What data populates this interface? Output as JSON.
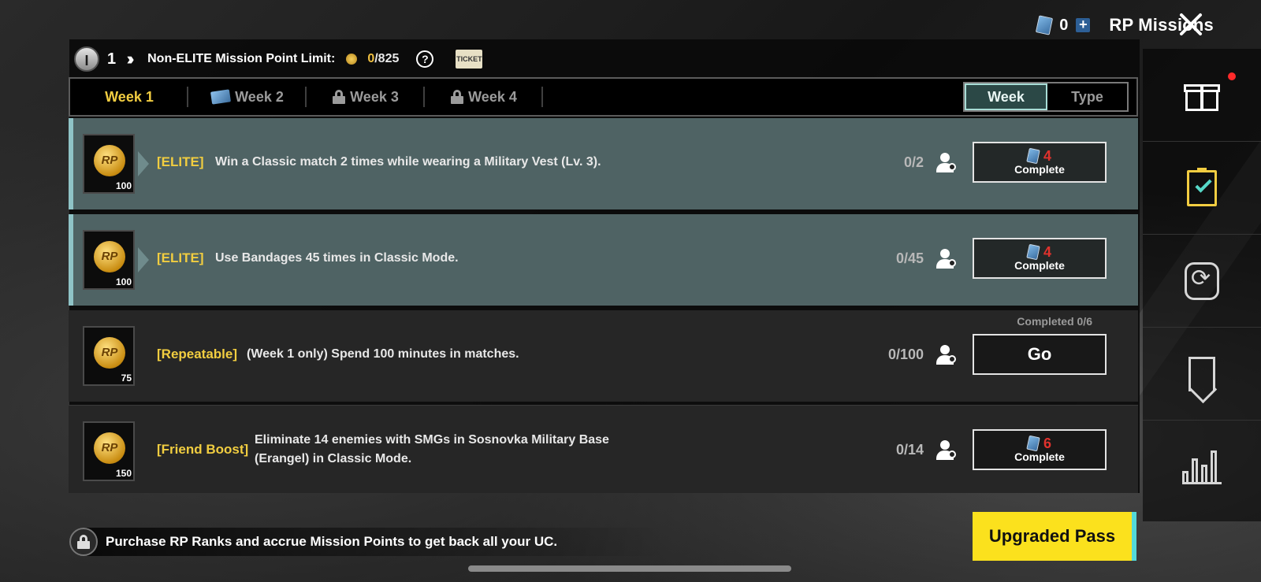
{
  "header": {
    "ticket_count": "0",
    "plus_symbol": "+",
    "title": "RP Missions"
  },
  "info": {
    "rank_letter": "I",
    "rank_number": "1",
    "limit_label": "Non-ELITE Mission Point Limit:",
    "limit_current": "0",
    "limit_max": "/825",
    "help_symbol": "?",
    "ticket_label": "TICKET"
  },
  "tabs": [
    {
      "label": "Week 1",
      "state": "active"
    },
    {
      "label": "Week 2",
      "state": "ticket"
    },
    {
      "label": "Week 3",
      "state": "locked"
    },
    {
      "label": "Week 4",
      "state": "locked"
    }
  ],
  "toggle": {
    "week": "Week",
    "type": "Type"
  },
  "missions": [
    {
      "tag": "[ELITE]",
      "description": "Win a Classic match 2 times while wearing a Military Vest (Lv. 3).",
      "progress": "0/2",
      "points": "100",
      "button_cost": "4",
      "button_label": "Complete"
    },
    {
      "tag": "[ELITE]",
      "description": "Use Bandages 45 times in Classic Mode.",
      "progress": "0/45",
      "points": "100",
      "button_cost": "4",
      "button_label": "Complete"
    },
    {
      "tag": "[Repeatable]",
      "description": "(Week 1 only) Spend 100 minutes in matches.",
      "progress": "0/100",
      "points": "75",
      "completed_note": "Completed 0/6",
      "button_label": "Go"
    },
    {
      "tag": "[Friend Boost]",
      "description": "Eliminate 14 enemies with SMGs in Sosnovka Military Base (Erangel) in Classic Mode.",
      "progress": "0/14",
      "points": "150",
      "button_cost": "6",
      "button_label": "Complete"
    }
  ],
  "coin_label": "RP",
  "bottom": {
    "text": "Purchase RP Ranks and accrue Mission Points to get back all your UC.",
    "upgrade_label": "Upgraded Pass"
  },
  "sidebar": [
    "gift-icon",
    "mission-clipboard-icon",
    "cycle-icon",
    "bookmark-icon",
    "stats-chart-icon"
  ],
  "colors": {
    "accent_gold": "#f2cd41",
    "elite_row": "#4f6364",
    "cost_red": "#e0322d",
    "upgrade_yellow": "#fbe11d"
  }
}
